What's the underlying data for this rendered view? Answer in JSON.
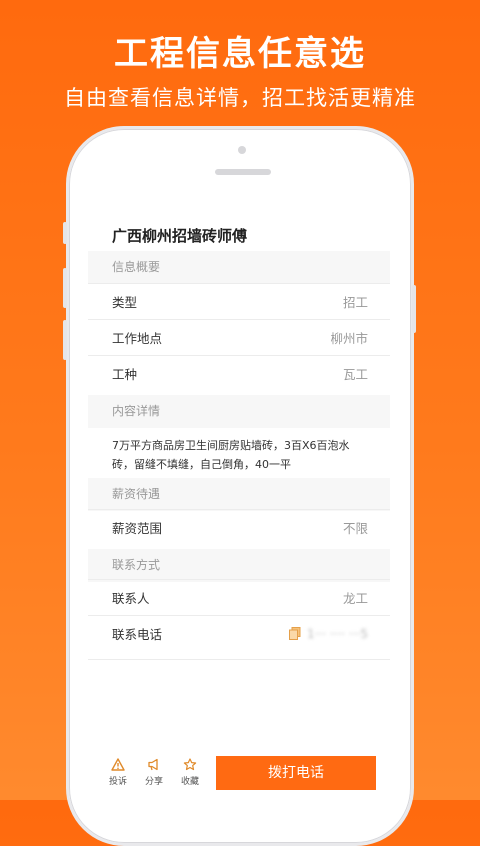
{
  "promo": {
    "headline": "工程信息任意选",
    "subline": "自由查看信息详情，招工找活更精准"
  },
  "job": {
    "title": "广西柳州招墙砖师傅",
    "sections": {
      "overview": "信息概要",
      "details": "内容详情",
      "salary": "薪资待遇",
      "contact": "联系方式"
    },
    "rows": {
      "type": {
        "label": "类型",
        "value": "招工"
      },
      "location": {
        "label": "工作地点",
        "value": "柳州市"
      },
      "trade": {
        "label": "工种",
        "value": "瓦工"
      },
      "salary_range": {
        "label": "薪资范围",
        "value": "不限"
      },
      "contact_person": {
        "label": "联系人",
        "value": "龙工"
      },
      "contact_phone": {
        "label": "联系电话",
        "value": "1··· ···· ···5"
      }
    },
    "content": "7万平方商品房卫生间厨房贴墙砖，3百X6百泡水砖，留缝不填缝，自己倒角，40一平"
  },
  "actions": {
    "report": "投诉",
    "share": "分享",
    "favorite": "收藏",
    "call": "拨打电话"
  },
  "colors": {
    "brand": "#ff6a12",
    "background_top": "#ff6a0e",
    "background_bottom": "#ff8a2e"
  }
}
